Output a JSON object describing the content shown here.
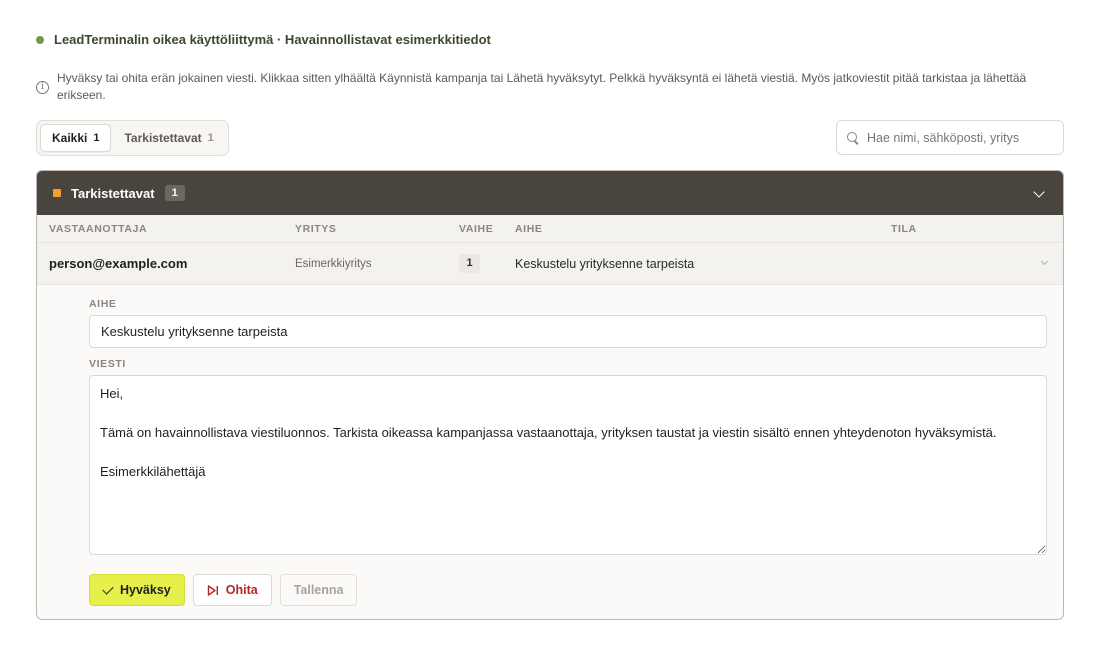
{
  "banner": {
    "text": "LeadTerminalin oikea käyttöliittymä · Havainnollistavat esimerkkitiedot",
    "dot_color": "#6f9a4a"
  },
  "info": {
    "icon": "info-icon",
    "text": "Hyväksy tai ohita erän jokainen viesti. Klikkaa sitten ylhäältä Käynnistä kampanja tai Lähetä hyväksytyt. Pelkkä hyväksyntä ei lähetä viestiä. Myös jatkoviestit pitää tarkistaa ja lähettää erikseen."
  },
  "filters": {
    "all": {
      "label": "Kaikki",
      "count": "1"
    },
    "review": {
      "label": "Tarkistettavat",
      "count": "1"
    }
  },
  "search": {
    "icon": "search-icon",
    "placeholder": "Hae nimi, sähköposti, yritys",
    "value": ""
  },
  "group": {
    "title": "Tarkistettavat",
    "count": "1",
    "accent_color": "#f0a030",
    "header_bg": "#4a443f"
  },
  "columns": {
    "recipient": "VASTAANOTTAJA",
    "company": "YRITYS",
    "step": "VAIHE",
    "subject": "AIHE",
    "status": "TILA"
  },
  "rows": [
    {
      "email": "person@example.com",
      "company": "Esimerkkiyritys",
      "step": "1",
      "subject": "Keskustelu yrityksenne tarpeista",
      "status": ""
    }
  ],
  "editor": {
    "subject_label": "AIHE",
    "subject_value": "Keskustelu yrityksenne tarpeista",
    "message_label": "VIESTI",
    "message_value": "Hei,\n\nTämä on havainnollistava viestiluonnos. Tarkista oikeassa kampanjassa vastaanottaja, yrityksen taustat ja viestin sisältö ennen yhteydenoton hyväksymistä.\n\nEsimerkkilähettäjä"
  },
  "actions": {
    "approve": "Hyväksy",
    "skip": "Ohita",
    "save": "Tallenna",
    "approve_color": "#e7ef4a",
    "skip_color": "#b5262b"
  }
}
